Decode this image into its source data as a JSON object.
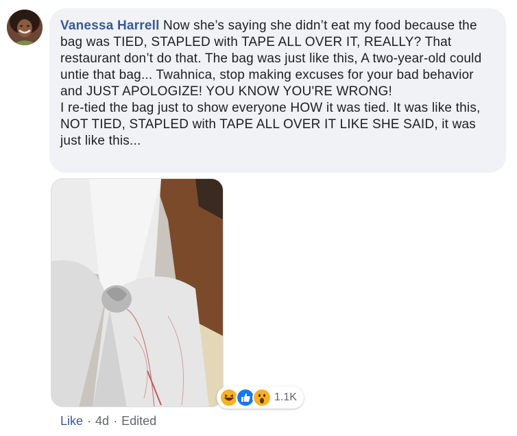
{
  "comment": {
    "author": "Vanessa Harrell",
    "text": "Now she’s saying she didn’t eat my food because the bag was TIED, STAPLED with TAPE ALL OVER IT, REALLY? That restaurant don’t do that. The bag was just like this, A two-year-old could untie that bag... Twahnica, stop making excuses for your bad behavior and JUST APOLOGIZE! YOU KNOW YOU'RE WRONG!\nI re-tied the bag just to show everyone HOW it was tied. It was like this, NOT TIED, STAPLED with TAPE ALL OVER IT LIKE SHE SAID, it was just like this..."
  },
  "reactions": {
    "icons": [
      "haha-icon",
      "like-icon",
      "wow-icon"
    ],
    "count": "1.1K"
  },
  "meta": {
    "like": "Like",
    "separator": "·",
    "time": "4d",
    "edited": "Edited"
  }
}
